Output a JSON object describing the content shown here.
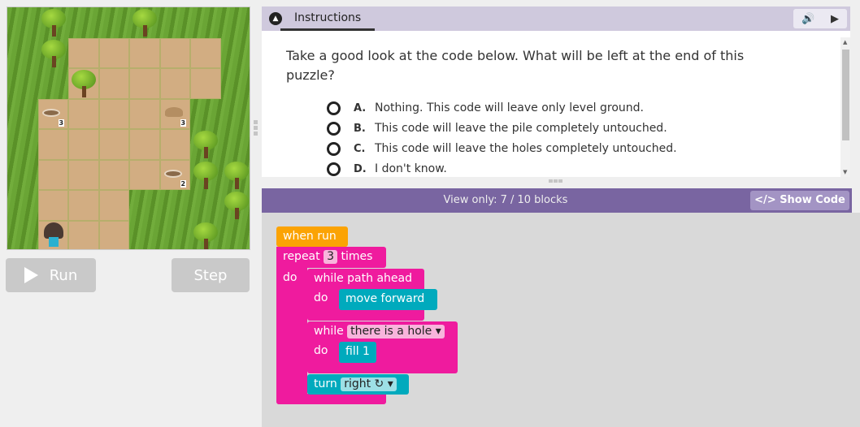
{
  "game": {
    "map": [
      "........",
      "..SSSSS.",
      "..SSSSS.",
      ".SSSSS..",
      ".SSSSS..",
      ".SSSSS..",
      ".SSS....",
      ".SSS...."
    ],
    "holes": [
      {
        "row": 3,
        "col": 1,
        "count": "3"
      },
      {
        "row": 5,
        "col": 5,
        "count": "2"
      }
    ],
    "piles": [
      {
        "row": 3,
        "col": 5,
        "count": "3"
      }
    ],
    "trees": [
      [
        1,
        0
      ],
      [
        4,
        0
      ],
      [
        1,
        1
      ],
      [
        2,
        2
      ],
      [
        6,
        4
      ],
      [
        6,
        5
      ],
      [
        7,
        5
      ],
      [
        7,
        6
      ],
      [
        6,
        7
      ]
    ],
    "avatar": {
      "row": 7,
      "col": 1
    },
    "run_label": "Run",
    "step_label": "Step"
  },
  "instructions": {
    "tab": "Instructions",
    "question": "Take a good look at the code below. What will be left at the end of this puzzle?",
    "options": [
      {
        "letter": "A.",
        "text": "Nothing. This code will leave only level ground."
      },
      {
        "letter": "B.",
        "text": "This code will leave the pile completely untouched."
      },
      {
        "letter": "C.",
        "text": "This code will leave the holes completely untouched."
      },
      {
        "letter": "D.",
        "text": "I don't know."
      }
    ]
  },
  "workspace": {
    "view_only": "View only: 7 / 10 blocks",
    "show_code": "Show Code",
    "show_code_icon": "</>",
    "blocks": {
      "when_run": "when run",
      "repeat": "repeat",
      "repeat_count": "3",
      "times": "times",
      "do": "do",
      "while1": "while path ahead",
      "do1": "do",
      "move": "move forward",
      "while2": "while",
      "cond2": "there is a hole ▾",
      "do2": "do",
      "fill": "fill 1",
      "turn": "turn",
      "dir": "right ↻ ▾"
    }
  },
  "colors": {
    "loop": "#ef1b9e",
    "action": "#00aabd",
    "event": "#fba304",
    "header": "#7965a1"
  }
}
